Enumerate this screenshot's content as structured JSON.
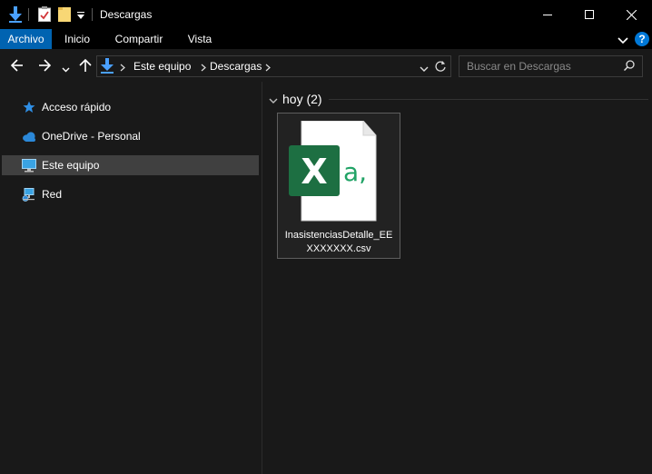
{
  "window": {
    "title": "Descargas"
  },
  "ribbon": {
    "tabs": [
      {
        "label": "Archivo",
        "active": true
      },
      {
        "label": "Inicio"
      },
      {
        "label": "Compartir"
      },
      {
        "label": "Vista"
      }
    ],
    "help_label": "?"
  },
  "address": {
    "segments": [
      "Este equipo",
      "Descargas"
    ]
  },
  "search": {
    "placeholder": "Buscar en Descargas"
  },
  "navpane": {
    "items": [
      {
        "label": "Acceso rápido",
        "icon": "star-icon"
      },
      {
        "label": "OneDrive - Personal",
        "icon": "cloud-icon"
      },
      {
        "label": "Este equipo",
        "icon": "computer-icon",
        "selected": true
      },
      {
        "label": "Red",
        "icon": "network-icon"
      }
    ]
  },
  "content": {
    "group_header": "hoy (2)",
    "files": [
      {
        "name_line1": "InasistenciasDetalle_EE",
        "name_line2": "XXXXXXX.csv",
        "icon": "excel-csv-icon",
        "icon_badge": "X",
        "icon_text": "a,"
      }
    ]
  },
  "colors": {
    "accent": "#0063b1",
    "excel_green": "#1d6f42",
    "excel_text": "#21a366",
    "selection": "#404040"
  }
}
